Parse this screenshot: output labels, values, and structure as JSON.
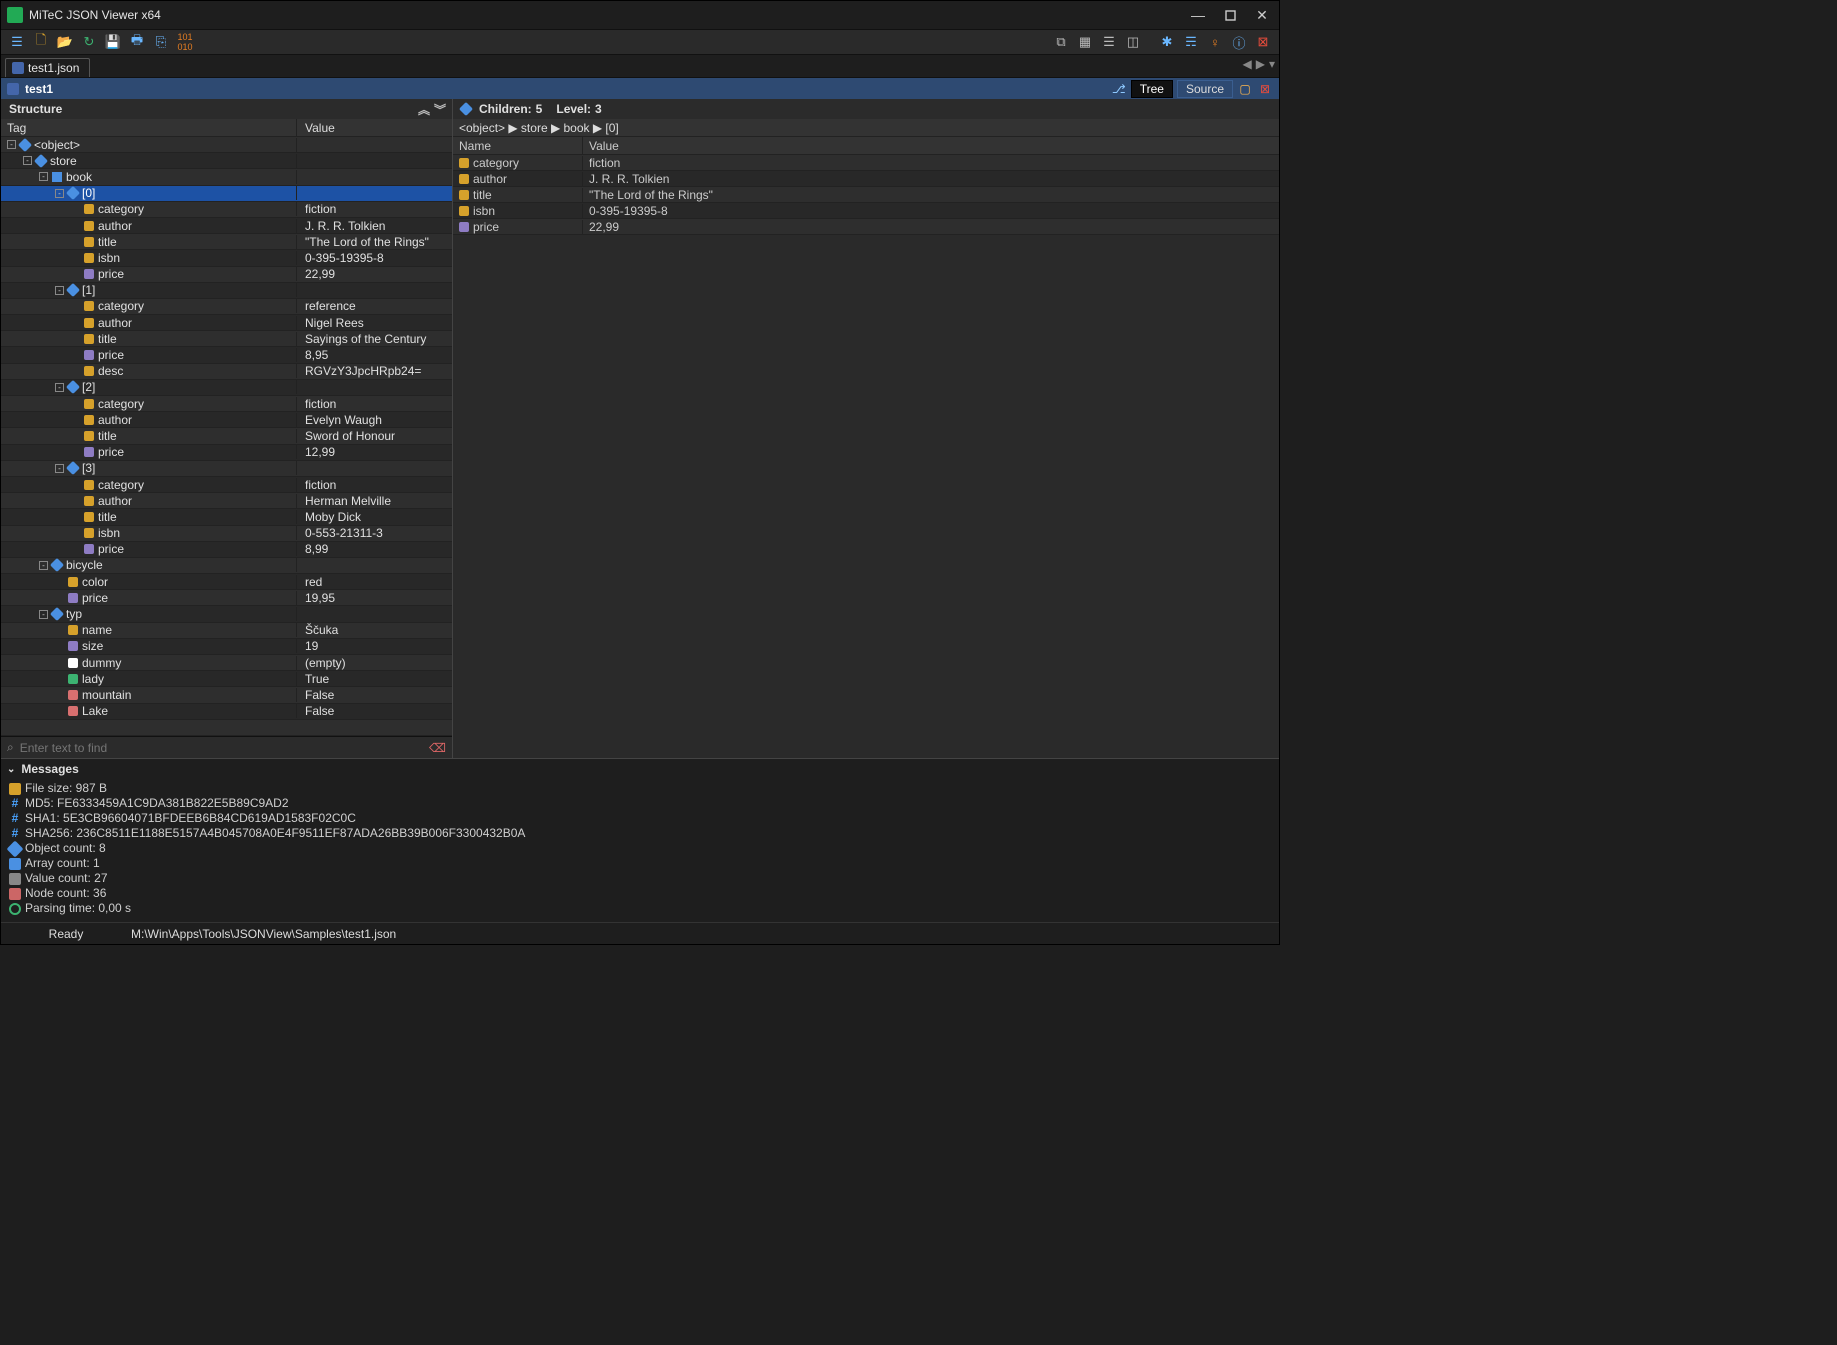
{
  "app_title": "MiTeC JSON Viewer x64",
  "file_tab": "test1.json",
  "path_bar_root": "test1",
  "modes": {
    "tree": "Tree",
    "source": "Source"
  },
  "left": {
    "header": "Structure",
    "col_tag": "Tag",
    "col_val": "Value",
    "find_placeholder": "Enter text to find"
  },
  "tree": [
    {
      "indent": 0,
      "exp": "-",
      "icon": "obj",
      "tag": "<object>",
      "val": ""
    },
    {
      "indent": 1,
      "exp": "-",
      "icon": "obj",
      "tag": "store",
      "val": ""
    },
    {
      "indent": 2,
      "exp": "-",
      "icon": "arr",
      "tag": "book",
      "val": ""
    },
    {
      "indent": 3,
      "exp": "-",
      "icon": "obj",
      "tag": "[0]",
      "val": "",
      "selected": true
    },
    {
      "indent": 4,
      "exp": "",
      "icon": "str",
      "tag": "category",
      "val": "fiction"
    },
    {
      "indent": 4,
      "exp": "",
      "icon": "str",
      "tag": "author",
      "val": "J. R. R. Tolkien"
    },
    {
      "indent": 4,
      "exp": "",
      "icon": "str",
      "tag": "title",
      "val": "\"The Lord of the Rings\""
    },
    {
      "indent": 4,
      "exp": "",
      "icon": "str",
      "tag": "isbn",
      "val": "0-395-19395-8"
    },
    {
      "indent": 4,
      "exp": "",
      "icon": "num",
      "tag": "price",
      "val": "22,99"
    },
    {
      "indent": 3,
      "exp": "-",
      "icon": "obj",
      "tag": "[1]",
      "val": ""
    },
    {
      "indent": 4,
      "exp": "",
      "icon": "str",
      "tag": "category",
      "val": "reference"
    },
    {
      "indent": 4,
      "exp": "",
      "icon": "str",
      "tag": "author",
      "val": "Nigel Rees"
    },
    {
      "indent": 4,
      "exp": "",
      "icon": "str",
      "tag": "title",
      "val": "Sayings of the Century"
    },
    {
      "indent": 4,
      "exp": "",
      "icon": "num",
      "tag": "price",
      "val": "8,95"
    },
    {
      "indent": 4,
      "exp": "",
      "icon": "str",
      "tag": "desc",
      "val": "RGVzY3JpcHRpb24="
    },
    {
      "indent": 3,
      "exp": "-",
      "icon": "obj",
      "tag": "[2]",
      "val": ""
    },
    {
      "indent": 4,
      "exp": "",
      "icon": "str",
      "tag": "category",
      "val": "fiction"
    },
    {
      "indent": 4,
      "exp": "",
      "icon": "str",
      "tag": "author",
      "val": "Evelyn Waugh"
    },
    {
      "indent": 4,
      "exp": "",
      "icon": "str",
      "tag": "title",
      "val": "Sword of Honour"
    },
    {
      "indent": 4,
      "exp": "",
      "icon": "num",
      "tag": "price",
      "val": "12,99"
    },
    {
      "indent": 3,
      "exp": "-",
      "icon": "obj",
      "tag": "[3]",
      "val": ""
    },
    {
      "indent": 4,
      "exp": "",
      "icon": "str",
      "tag": "category",
      "val": "fiction"
    },
    {
      "indent": 4,
      "exp": "",
      "icon": "str",
      "tag": "author",
      "val": "Herman Melville"
    },
    {
      "indent": 4,
      "exp": "",
      "icon": "str",
      "tag": "title",
      "val": "Moby Dick"
    },
    {
      "indent": 4,
      "exp": "",
      "icon": "str",
      "tag": "isbn",
      "val": "0-553-21311-3"
    },
    {
      "indent": 4,
      "exp": "",
      "icon": "num",
      "tag": "price",
      "val": "8,99"
    },
    {
      "indent": 2,
      "exp": "-",
      "icon": "obj",
      "tag": "bicycle",
      "val": ""
    },
    {
      "indent": 3,
      "exp": "",
      "icon": "str",
      "tag": "color",
      "val": "red"
    },
    {
      "indent": 3,
      "exp": "",
      "icon": "num",
      "tag": "price",
      "val": "19,95"
    },
    {
      "indent": 2,
      "exp": "-",
      "icon": "obj",
      "tag": "typ",
      "val": ""
    },
    {
      "indent": 3,
      "exp": "",
      "icon": "str",
      "tag": "name",
      "val": "Ščuka"
    },
    {
      "indent": 3,
      "exp": "",
      "icon": "num",
      "tag": "size",
      "val": "19"
    },
    {
      "indent": 3,
      "exp": "",
      "icon": "emp",
      "tag": "dummy",
      "val": "(empty)"
    },
    {
      "indent": 3,
      "exp": "",
      "icon": "true",
      "tag": "lady",
      "val": "True"
    },
    {
      "indent": 3,
      "exp": "",
      "icon": "false",
      "tag": "mountain",
      "val": "False"
    },
    {
      "indent": 3,
      "exp": "",
      "icon": "false",
      "tag": "Lake",
      "val": "False"
    }
  ],
  "detail": {
    "summary_children_label": "Children:",
    "summary_children": "5",
    "summary_level_label": "Level:",
    "summary_level": "3",
    "breadcrumb": "<object> ▶ store ▶ book ▶ [0]",
    "col_name": "Name",
    "col_val": "Value",
    "rows": [
      {
        "icon": "str",
        "name": "category",
        "val": "fiction"
      },
      {
        "icon": "str",
        "name": "author",
        "val": "J. R. R. Tolkien"
      },
      {
        "icon": "str",
        "name": "title",
        "val": "\"The Lord of the Rings\""
      },
      {
        "icon": "str",
        "name": "isbn",
        "val": "0-395-19395-8"
      },
      {
        "icon": "num",
        "name": "price",
        "val": "22,99"
      }
    ]
  },
  "messages": {
    "header": "Messages",
    "lines": [
      {
        "icon": "file",
        "text": "File size: 987 B"
      },
      {
        "icon": "hash",
        "text": "MD5: FE6333459A1C9DA381B822E5B89C9AD2"
      },
      {
        "icon": "hash",
        "text": "SHA1: 5E3CB96604071BFDEEB6B84CD619AD1583F02C0C"
      },
      {
        "icon": "hash",
        "text": "SHA256: 236C8511E1188E5157A4B045708A0E4F9511EF87ADA26BB39B006F3300432B0A"
      },
      {
        "icon": "obj",
        "text": "Object count: 8"
      },
      {
        "icon": "arr",
        "text": "Array count: 1"
      },
      {
        "icon": "val",
        "text": "Value count: 27"
      },
      {
        "icon": "node",
        "text": "Node count: 36"
      },
      {
        "icon": "time",
        "text": "Parsing time: 0,00 s"
      }
    ]
  },
  "status": {
    "ready": "Ready",
    "path": "M:\\Win\\Apps\\Tools\\JSONView\\Samples\\test1.json"
  }
}
